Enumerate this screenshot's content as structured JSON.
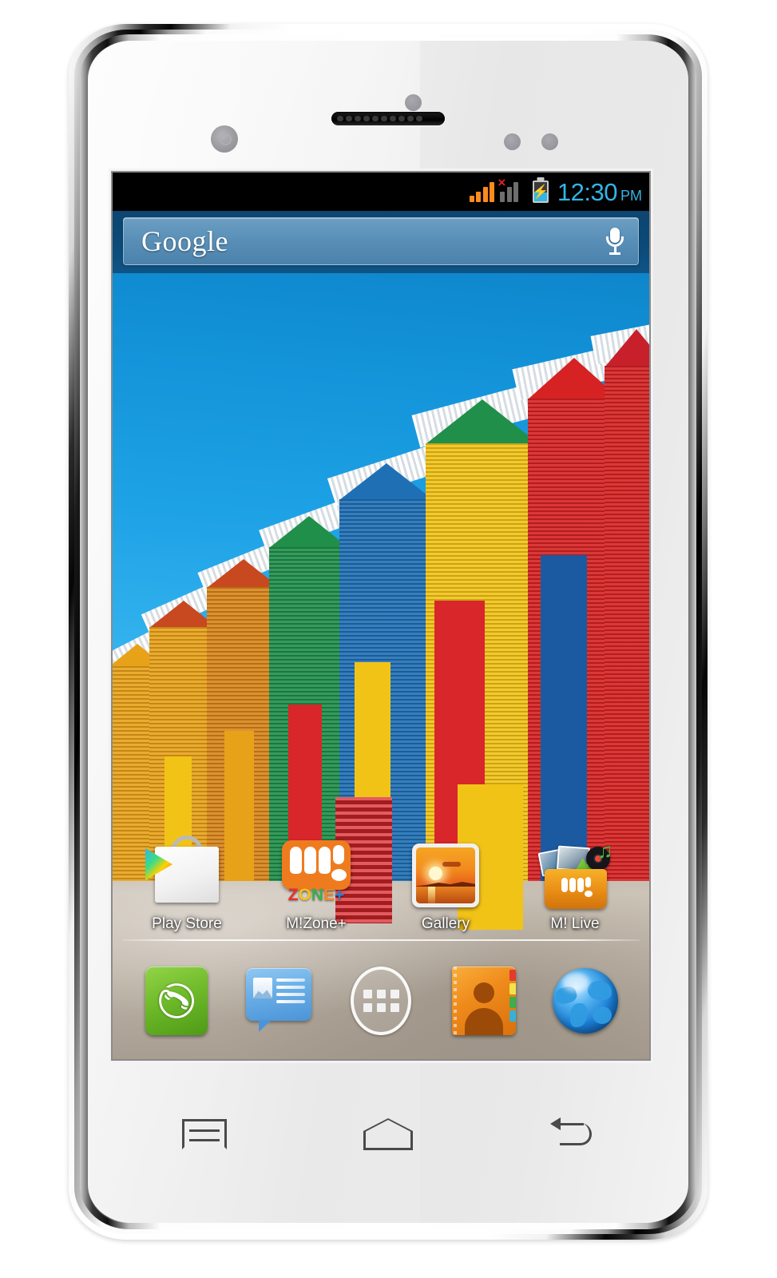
{
  "device": {
    "name": "Micromax Android smartphone",
    "hardware": {
      "earpiece": "earpiece-speaker",
      "front_camera": "front-camera",
      "proximity_sensor": "proximity-sensor",
      "light_sensor": "light-sensor",
      "notification_led": "notification-led"
    }
  },
  "statusbar": {
    "signal_primary_icon": "signal-bars-icon",
    "signal_secondary_icon": "signal-bars-no-service-icon",
    "no_service_mark": "×",
    "battery_icon": "battery-charging-icon",
    "battery_bolt": "⚡",
    "time": "12:30",
    "ampm": "PM",
    "time_color": "#33b5e5",
    "signal_color": "#ff8a1e",
    "signal_inactive_color": "#6e6e6e",
    "no_service_color": "#e02020",
    "background": "#000000"
  },
  "search": {
    "logo_text": "Google",
    "voice_icon": "microphone-icon",
    "bar_color": "#5a90b8",
    "band_color": "#0b4a79"
  },
  "wallpaper": {
    "name": "colorful-beach-huts-wallpaper",
    "sky_color": "#1ea2e6",
    "sand_color": "#c2b8ab",
    "hut_colors": [
      "#c8481f",
      "#e8a219",
      "#1f6fb5",
      "#1f8f4a",
      "#d8262a",
      "#f2c317",
      "#1b5aa0",
      "#d62222"
    ]
  },
  "homescreen": {
    "apps": [
      {
        "label": "Play Store",
        "icon": "play-store-icon"
      },
      {
        "label": "M!Zone+",
        "icon": "mzone-plus-icon",
        "badge_text": "ZONE+"
      },
      {
        "label": "Gallery",
        "icon": "gallery-icon"
      },
      {
        "label": "M! Live",
        "icon": "m-live-folder-icon"
      }
    ]
  },
  "dock": {
    "items": [
      {
        "name": "phone",
        "icon": "phone-icon",
        "color": "#6fbb2a"
      },
      {
        "name": "messaging",
        "icon": "messaging-icon",
        "color": "#69aee6"
      },
      {
        "name": "app-drawer",
        "icon": "app-drawer-icon",
        "color": "#f2f2f2"
      },
      {
        "name": "contacts",
        "icon": "contacts-icon",
        "color": "#ef8b1b"
      },
      {
        "name": "browser",
        "icon": "browser-globe-icon",
        "color": "#1b7fd6"
      }
    ]
  },
  "navbar": {
    "buttons": [
      {
        "name": "menu",
        "icon": "menu-icon"
      },
      {
        "name": "home",
        "icon": "home-icon"
      },
      {
        "name": "back",
        "icon": "back-icon"
      }
    ]
  }
}
